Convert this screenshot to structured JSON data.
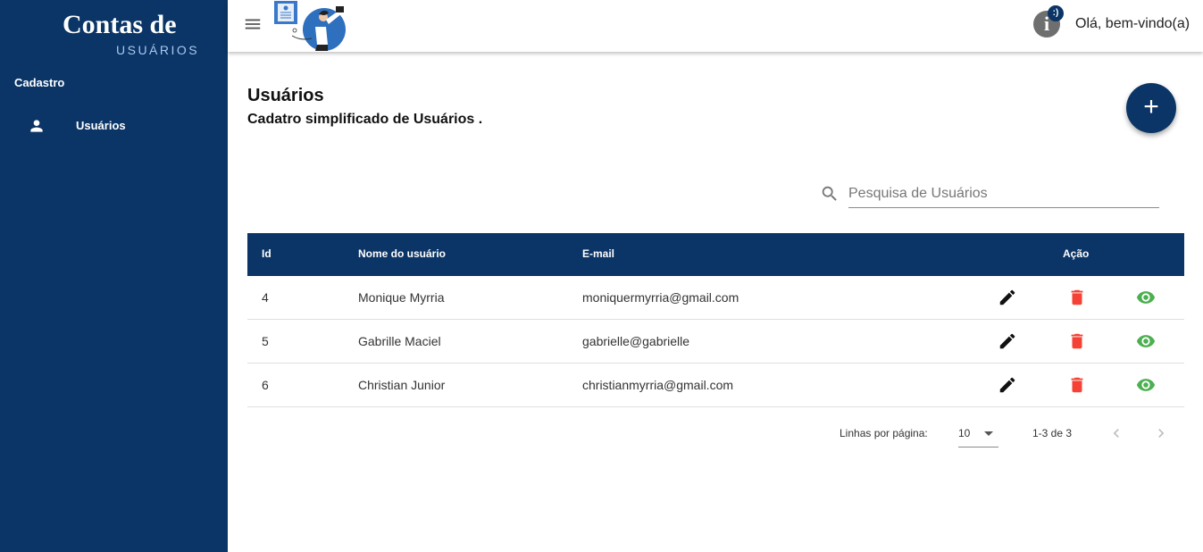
{
  "sidebar": {
    "logo_title": "Contas de",
    "logo_subtitle": "USUÁRIOS",
    "section_label": "Cadastro",
    "items": [
      {
        "label": "Usuários",
        "icon": "person-icon"
      }
    ]
  },
  "header": {
    "menu_icon": "hamburger-menu-icon",
    "illustration": "user-profile-illustration",
    "info_icon": "info-icon",
    "badge_text": ":)",
    "greeting": "Olá, bem-vindo(a)"
  },
  "main": {
    "title": "Usuários",
    "subtitle": "Cadatro simplificado de Usuários .",
    "add_button_label": "+",
    "search": {
      "placeholder": "Pesquisa de Usuários",
      "value": ""
    },
    "table": {
      "columns": [
        "Id",
        "Nome do usuário",
        "E-mail",
        "Ação"
      ],
      "rows": [
        {
          "id": "4",
          "name": "Monique Myrria",
          "email": "moniquermyrria@gmail.com"
        },
        {
          "id": "5",
          "name": "Gabrille Maciel",
          "email": "gabrielle@gabrielle"
        },
        {
          "id": "6",
          "name": "Christian Junior",
          "email": "christianmyrria@gmail.com"
        }
      ]
    },
    "pagination": {
      "rows_per_page_label": "Linhas por página:",
      "rows_per_page_value": "10",
      "range_label": "1-3 de 3"
    }
  },
  "colors": {
    "primary": "#0b3566",
    "delete": "#f44336",
    "view": "#4caf50",
    "edit": "#111111"
  }
}
